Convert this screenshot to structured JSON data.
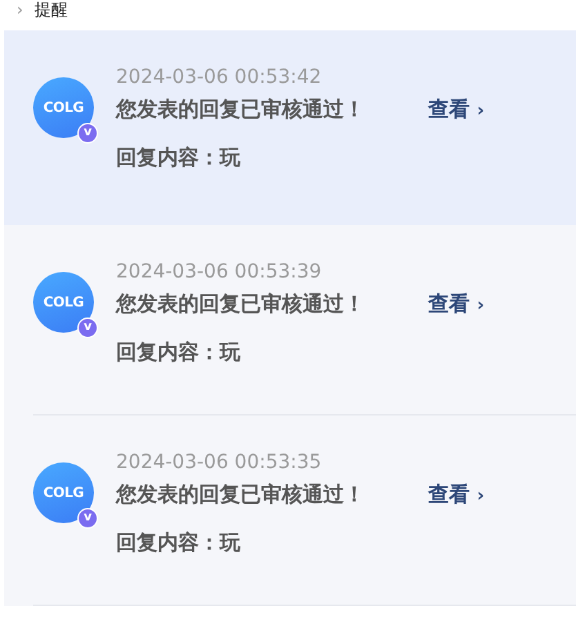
{
  "breadcrumb": {
    "separator": "›",
    "current": "提醒"
  },
  "notifications": [
    {
      "avatar_text": "COLG",
      "badge": "v",
      "time": "2024-03-06 00:53:42",
      "title": "您发表的回复已审核通过！",
      "link": "查看",
      "link_arrow": "›",
      "content": "回复内容：玩",
      "selected": true
    },
    {
      "avatar_text": "COLG",
      "badge": "v",
      "time": "2024-03-06 00:53:39",
      "title": "您发表的回复已审核通过！",
      "link": "查看",
      "link_arrow": "›",
      "content": "回复内容：玩",
      "selected": false
    },
    {
      "avatar_text": "COLG",
      "badge": "v",
      "time": "2024-03-06 00:53:35",
      "title": "您发表的回复已审核通过！",
      "link": "查看",
      "link_arrow": "›",
      "content": "回复内容：玩",
      "selected": false
    }
  ]
}
